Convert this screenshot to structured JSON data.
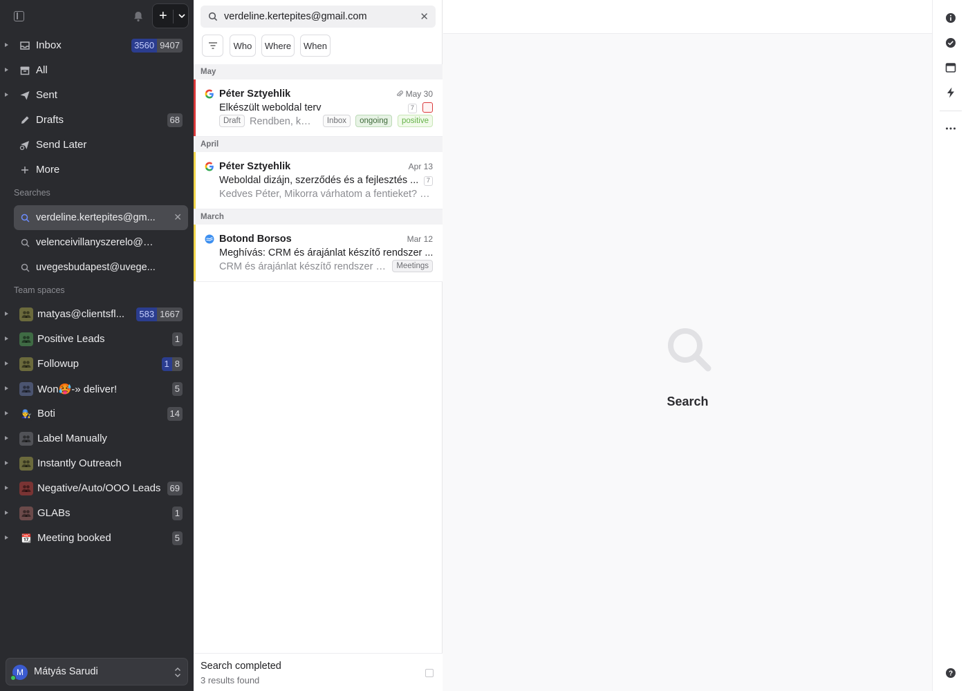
{
  "sidebar": {
    "nav": [
      {
        "label": "Inbox",
        "icon": "inbox-icon",
        "badges": [
          {
            "text": "3560",
            "tone": "blue"
          },
          {
            "text": "9407",
            "tone": "gray"
          }
        ]
      },
      {
        "label": "All",
        "icon": "archive-icon",
        "badges": []
      },
      {
        "label": "Sent",
        "icon": "send-icon",
        "badges": []
      },
      {
        "label": "Drafts",
        "icon": "pencil-icon",
        "badges": [
          {
            "text": "68",
            "tone": "gray"
          }
        ]
      },
      {
        "label": "Send Later",
        "icon": "send-later-icon",
        "badges": []
      },
      {
        "label": "More",
        "icon": "plus-icon",
        "badges": []
      }
    ],
    "searches_title": "Searches",
    "searches": [
      {
        "label": "verdeline.kertepites@gm...",
        "active": true
      },
      {
        "label": "velenceivillanyszerelo@g...",
        "active": false
      },
      {
        "label": "uvegesbudapest@uvege...",
        "active": false
      }
    ],
    "team_title": "Team spaces",
    "teams": [
      {
        "label": "matyas@clientsfl...",
        "avatar_color": "#6b6a3c",
        "glyph": "",
        "badges": [
          {
            "text": "583",
            "tone": "blue"
          },
          {
            "text": "1667",
            "tone": "gray"
          }
        ]
      },
      {
        "label": "Positive Leads",
        "avatar_color": "#3f6b44",
        "glyph": "",
        "badges": [
          {
            "text": "1",
            "tone": "gray"
          }
        ]
      },
      {
        "label": "Followup",
        "avatar_color": "#6b6a3c",
        "glyph": "",
        "badges": [
          {
            "text": "1",
            "tone": "blue"
          },
          {
            "text": "8",
            "tone": "gray"
          }
        ]
      },
      {
        "label": "Won🥵-» deliver!",
        "avatar_color": "#4b5470",
        "glyph": "",
        "badges": [
          {
            "text": "5",
            "tone": "gray"
          }
        ]
      },
      {
        "label": "Boti",
        "avatar_color": "#2a2b2f",
        "glyph": "👨‍🔧",
        "badges": [
          {
            "text": "14",
            "tone": "gray"
          }
        ]
      },
      {
        "label": "Label Manually",
        "avatar_color": "#515257",
        "glyph": "",
        "badges": []
      },
      {
        "label": "Instantly Outreach",
        "avatar_color": "#6b6a3c",
        "glyph": "",
        "badges": []
      },
      {
        "label": "Negative/Auto/OOO Leads",
        "avatar_color": "#7a3434",
        "glyph": "",
        "badges": [
          {
            "text": "69",
            "tone": "gray"
          }
        ]
      },
      {
        "label": "GLABs",
        "avatar_color": "#6b4a4a",
        "glyph": "",
        "badges": [
          {
            "text": "1",
            "tone": "gray"
          }
        ]
      },
      {
        "label": "Meeting booked",
        "avatar_color": "#2a2b2f",
        "glyph": "📆",
        "badges": [
          {
            "text": "5",
            "tone": "gray"
          }
        ]
      }
    ],
    "user": {
      "initial": "M",
      "name": "Mátyás Sarudi"
    }
  },
  "search": {
    "query": "verdeline.kertepites@gmail.com",
    "filters": [
      "Who",
      "Where",
      "When"
    ]
  },
  "groups": [
    {
      "month": "May",
      "mails": [
        {
          "sender": "Péter Sztyehlik",
          "date": "May 30",
          "subject": "Elkészült weboldal terv",
          "count": "7",
          "preview": "Rendben, kös...",
          "draft": "Draft",
          "labels": [
            "Inbox",
            "ongoing",
            "positive"
          ],
          "bar_color": "#d9383a",
          "source": "google",
          "attachment": true
        }
      ]
    },
    {
      "month": "April",
      "mails": [
        {
          "sender": "Péter Sztyehlik",
          "date": "Apr 13",
          "subject": "Weboldal dizájn, szerződés és a fejlesztés ...",
          "count": "7",
          "preview": "Kedves Péter, Mikorra várhatom a fentieket? Ü...",
          "draft": "",
          "labels": [],
          "bar_color": "#f2d64b",
          "source": "google",
          "attachment": false
        }
      ]
    },
    {
      "month": "March",
      "mails": [
        {
          "sender": "Botond Borsos",
          "date": "Mar 12",
          "subject": "Meghívás: CRM és árajánlat készítő rendszer ...",
          "count": "",
          "preview": "CRM és árajánlat készítő rendszer e...",
          "draft": "",
          "labels": [
            "Meetings"
          ],
          "bar_color": "#f2d64b",
          "source": "calendar",
          "attachment": false
        }
      ]
    }
  ],
  "status": {
    "title": "Search completed",
    "subtitle": "3 results found"
  },
  "reader": {
    "empty_label": "Search"
  },
  "colors": {
    "sidebar_bg": "#2a2b2f",
    "accent_blue": "#2b3d8f",
    "flag_red": "#d9383a",
    "flag_yellow": "#f2d64b"
  }
}
